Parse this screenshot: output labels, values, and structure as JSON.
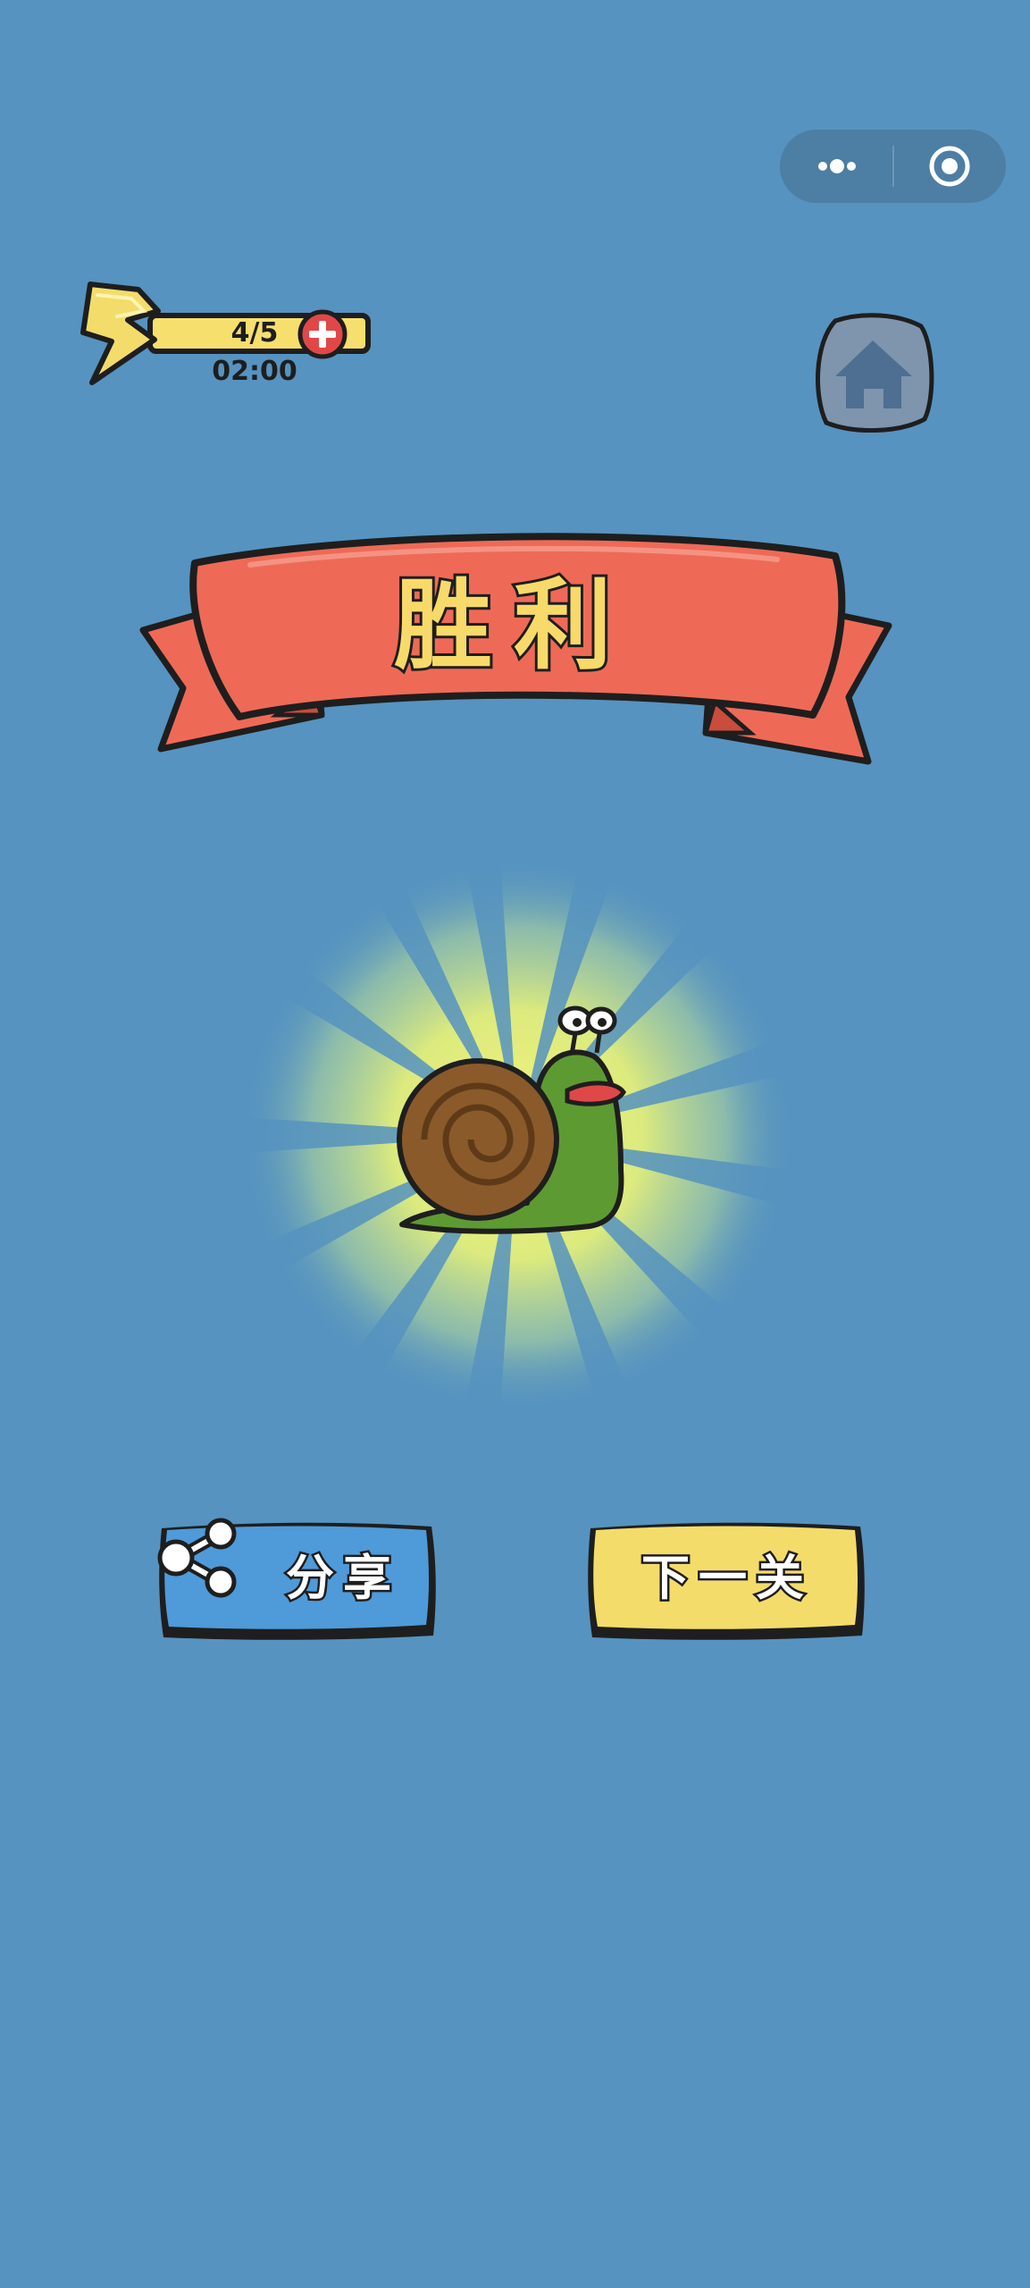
{
  "capsule": {
    "more_icon": "more-dots-icon",
    "close_icon": "target-circle-icon"
  },
  "energy": {
    "count": "4/5",
    "timer": "02:00",
    "bolt_icon": "lightning-bolt-icon",
    "add_icon": "plus-icon"
  },
  "home": {
    "icon": "home-icon"
  },
  "banner": {
    "title": "胜利"
  },
  "buttons": {
    "share_label": "分享",
    "share_icon": "share-icon",
    "next_label": "下一关"
  },
  "colors": {
    "background": "#5693c0",
    "banner": "#ee6a57",
    "title_text": "#f8da6a",
    "share_button": "#4f9ad9",
    "next_button": "#f4dc6b",
    "plus_button": "#e04848",
    "home_button": "#7e95ad"
  }
}
